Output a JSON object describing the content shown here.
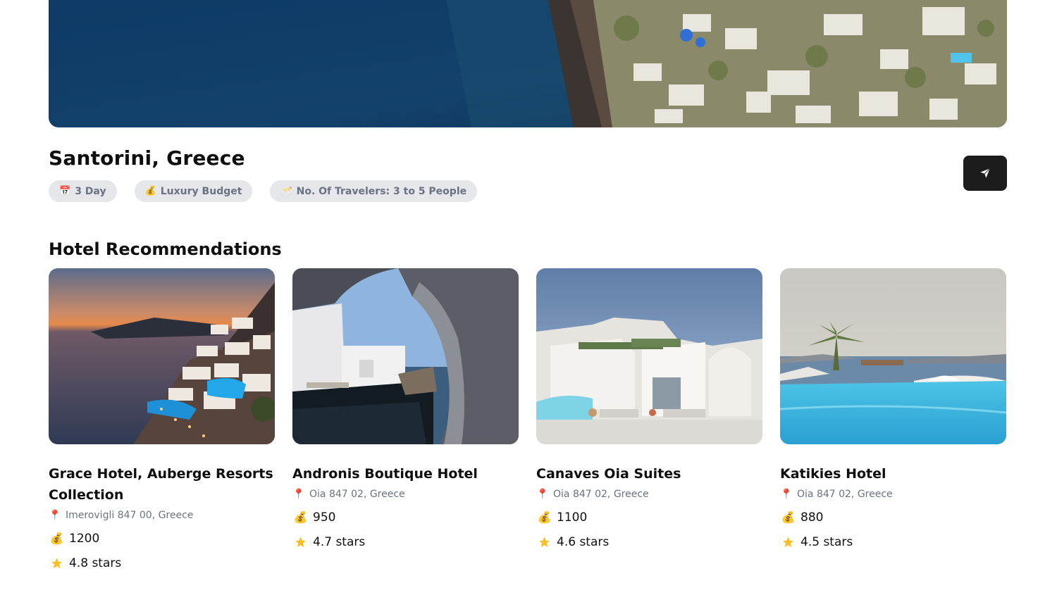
{
  "trip": {
    "destination": "Santorini, Greece",
    "chips": [
      {
        "icon": "calendar-icon",
        "glyph": "📅",
        "label": "3 Day"
      },
      {
        "icon": "money-bag-icon",
        "glyph": "💰",
        "label": "Luxury Budget"
      },
      {
        "icon": "travelers-icon",
        "glyph": "🥂",
        "label": "No. Of Travelers: 3 to 5 People"
      }
    ]
  },
  "share_button": {
    "icon": "send-icon"
  },
  "hotels_section": {
    "title": "Hotel Recommendations",
    "hotels": [
      {
        "name": "Grace Hotel, Auberge Resorts Collection",
        "address": "Imerovigli 847 00, Greece",
        "price": "1200",
        "rating": "4.8 stars"
      },
      {
        "name": "Andronis Boutique Hotel",
        "address": "Oia 847 02, Greece",
        "price": "950",
        "rating": "4.7 stars"
      },
      {
        "name": "Canaves Oia Suites",
        "address": "Oia 847 02, Greece",
        "price": "1100",
        "rating": "4.6 stars"
      },
      {
        "name": "Katikies Hotel",
        "address": "Oia 847 02, Greece",
        "price": "880",
        "rating": "4.5 stars"
      }
    ],
    "pin_glyph": "📍",
    "price_glyph": "💰"
  },
  "colors": {
    "chip_bg": "#e5e7eb",
    "chip_text": "#6b7280",
    "button_bg": "#1c1c1c",
    "star": "#fbbf24",
    "pin": "#ec4899"
  }
}
